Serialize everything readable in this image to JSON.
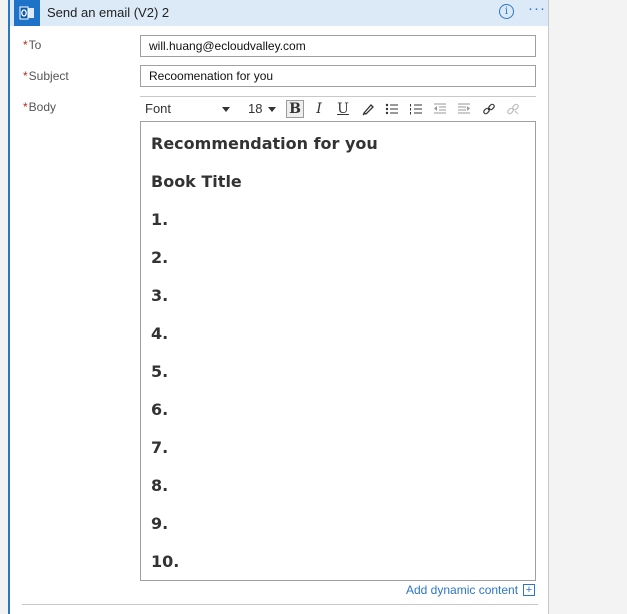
{
  "header": {
    "title": "Send an email (V2) 2",
    "info_icon": "info-circle-icon",
    "more_icon": "ellipsis-icon",
    "app_icon": "outlook-icon"
  },
  "fields": {
    "to": {
      "label": "To",
      "value": "will.huang@ecloudvalley.com"
    },
    "subject": {
      "label": "Subject",
      "value": "Recoomenation for you"
    },
    "body": {
      "label": "Body"
    }
  },
  "required_mark": "*",
  "toolbar": {
    "font": "Font",
    "size": "18",
    "bold": "B",
    "italic": "I",
    "underline": "U",
    "icons": [
      "highlight-icon",
      "bullet-list-icon",
      "numbered-list-icon",
      "outdent-icon",
      "indent-icon",
      "link-icon",
      "unlink-icon"
    ]
  },
  "editor": {
    "heading1": "Recommendation for you",
    "heading2": "Book Title",
    "items": [
      "1.",
      "2.",
      "3.",
      "4.",
      "5.",
      "6.",
      "7.",
      "8.",
      "9.",
      "10."
    ]
  },
  "footer": {
    "dynamic_content": "Add dynamic content"
  },
  "colors": {
    "accent": "#2c76c8",
    "header_bg": "#dceaf8",
    "required": "#c0261b"
  }
}
